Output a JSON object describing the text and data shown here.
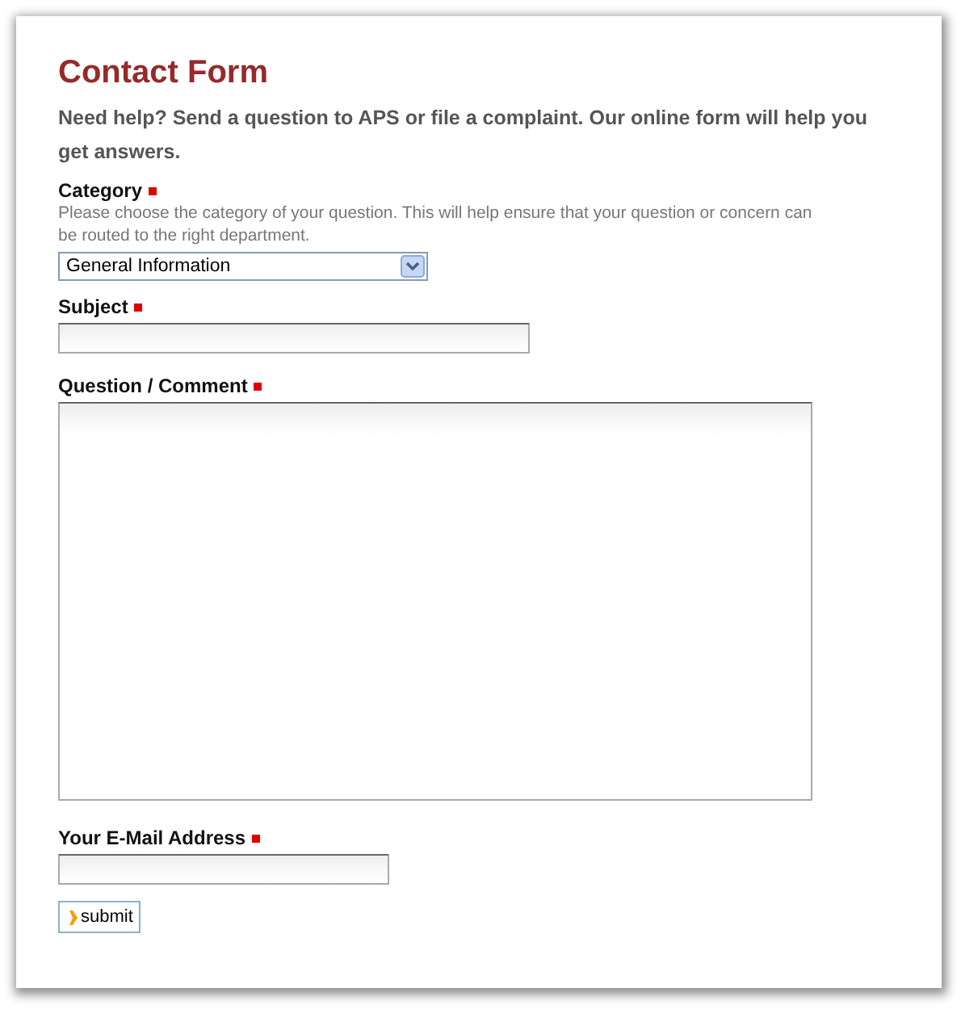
{
  "title": "Contact Form",
  "intro": "Need help? Send a question to APS or file a complaint. Our online form will help you get answers.",
  "fields": [
    {
      "kind": "select",
      "label": "Category",
      "required": true,
      "hint": "Please choose the category of your question. This will help ensure that your question or concern can be routed to the right department.",
      "dropdown": {
        "value": "General Information"
      }
    },
    {
      "kind": "text",
      "label": "Subject",
      "required": true
    },
    {
      "kind": "textarea",
      "label": "Question / Comment",
      "required": true
    },
    {
      "kind": "email",
      "label": "Your E-Mail Address",
      "required": true
    }
  ],
  "submit": "submit"
}
